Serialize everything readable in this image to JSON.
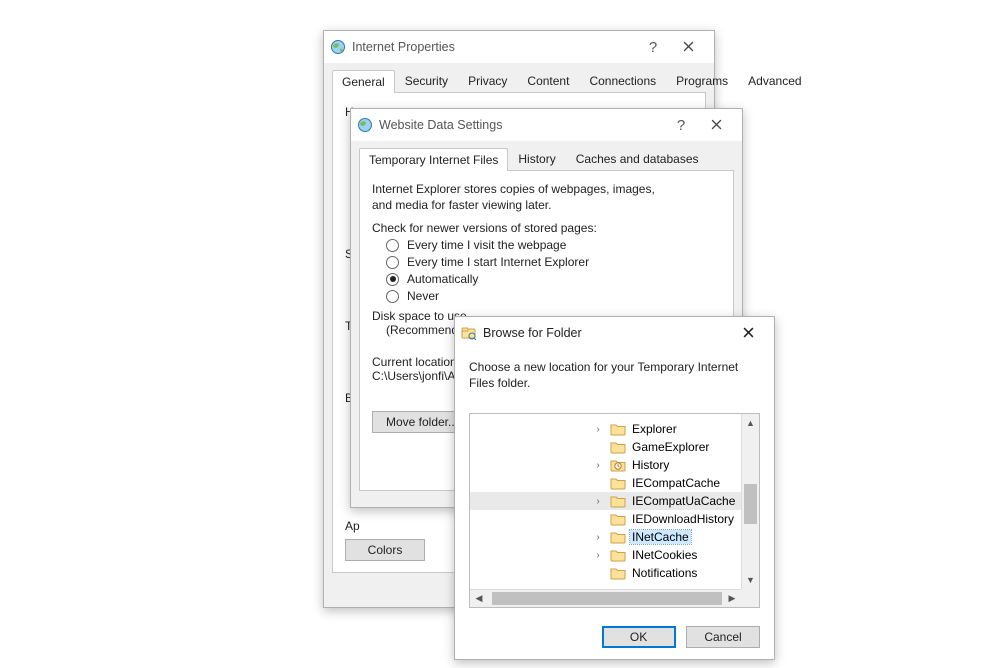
{
  "internet_properties": {
    "title": "Internet Properties",
    "tabs": [
      "General",
      "Security",
      "Privacy",
      "Content",
      "Connections",
      "Programs",
      "Advanced"
    ],
    "active_tab": 0,
    "homepage_heading": "Ho",
    "startup_heading": "St",
    "tabs_heading": "Ta",
    "browsing_heading": "Br",
    "appearance_heading": "Ap",
    "colors_button": "Colors"
  },
  "website_data": {
    "title": "Website Data Settings",
    "tabs": [
      "Temporary Internet Files",
      "History",
      "Caches and databases"
    ],
    "active_tab": 0,
    "desc": "Internet Explorer stores copies of webpages, images, and media for faster viewing later.",
    "check_label": "Check for newer versions of stored pages:",
    "radio_options": [
      "Every time I visit the webpage",
      "Every time I start Internet Explorer",
      "Automatically",
      "Never"
    ],
    "radio_selected": 2,
    "disk_space_a": "Disk space to use",
    "disk_space_b": "(Recommended",
    "current_location_label": "Current location:",
    "current_location_value": "C:\\Users\\jonfi\\Ap",
    "move_folder_button": "Move folder..."
  },
  "browse": {
    "title": "Browse for Folder",
    "desc": "Choose a new location for your Temporary Internet Files folder.",
    "items": [
      {
        "name": "Explorer",
        "expandable": true,
        "icon": "folder"
      },
      {
        "name": "GameExplorer",
        "expandable": false,
        "icon": "folder"
      },
      {
        "name": "History",
        "expandable": true,
        "icon": "history"
      },
      {
        "name": "IECompatCache",
        "expandable": false,
        "icon": "folder"
      },
      {
        "name": "IECompatUaCache",
        "expandable": true,
        "icon": "folder",
        "highlight": true
      },
      {
        "name": "IEDownloadHistory",
        "expandable": false,
        "icon": "folder"
      },
      {
        "name": "INetCache",
        "expandable": true,
        "icon": "folder",
        "selected": true
      },
      {
        "name": "INetCookies",
        "expandable": true,
        "icon": "folder"
      },
      {
        "name": "Notifications",
        "expandable": false,
        "icon": "folder"
      }
    ],
    "ok_button": "OK",
    "cancel_button": "Cancel"
  }
}
